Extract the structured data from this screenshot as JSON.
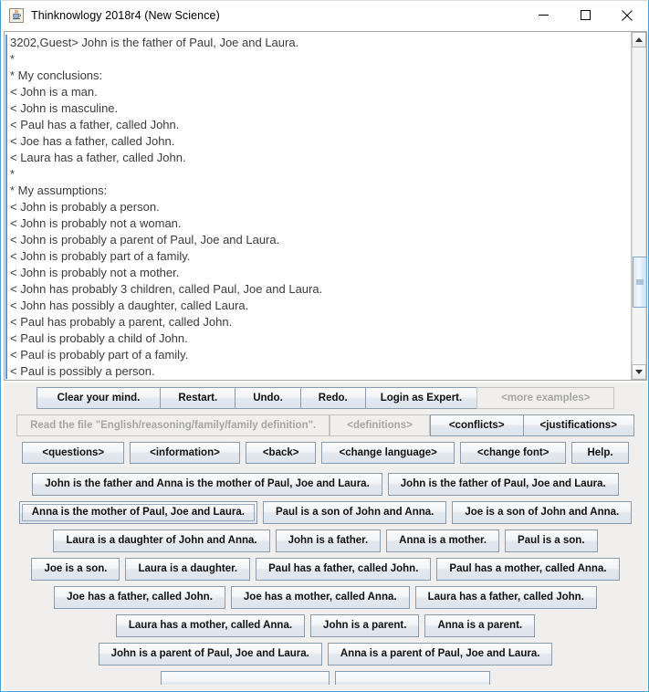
{
  "window": {
    "title": "Thinknowlogy 2018r4 (New Science)",
    "app_icon": "java-coffee-cup-icon",
    "minimize_label": "—",
    "maximize_label": "□",
    "close_label": "✕",
    "border_color": "#4a9fd8"
  },
  "output": {
    "lines": [
      "3202,Guest> John is the father of Paul, Joe and Laura.",
      "*",
      "* My conclusions:",
      "< John is a man.",
      "< John is masculine.",
      "< Paul has a father, called John.",
      "< Joe has a father, called John.",
      "< Laura has a father, called John.",
      "*",
      "* My assumptions:",
      "< John is probably a person.",
      "< John is probably not a woman.",
      "< John is probably a parent of Paul, Joe and Laura.",
      "< John is probably part of a family.",
      "< John is probably not a mother.",
      "< John has probably 3 children, called Paul, Joe and Laura.",
      "< John has possibly a daughter, called Laura.",
      "< Paul has probably a parent, called John.",
      "< Paul is probably a child of John.",
      "< Paul is probably part of a family.",
      "< Paul is possibly a person."
    ],
    "scrollbar": {
      "up_arrow": "scroll-up-arrow-icon",
      "down_arrow": "scroll-down-arrow-icon",
      "thumb_top_pct": 66,
      "thumb_height_pct": 16
    }
  },
  "toolbar": [
    {
      "label": "Clear your mind.",
      "enabled": true
    },
    {
      "label": "Restart.",
      "enabled": true
    },
    {
      "label": "Undo.",
      "enabled": true
    },
    {
      "label": "Redo.",
      "enabled": true
    },
    {
      "label": "Login as Expert.",
      "enabled": true
    },
    {
      "label": "<more examples>",
      "enabled": false
    }
  ],
  "file_row": [
    {
      "label": "Read the file \"English/reasoning/family/family definition\".",
      "enabled": false
    },
    {
      "label": "<definitions>",
      "enabled": false
    },
    {
      "label": "<conflicts>",
      "enabled": true
    },
    {
      "label": "<justifications>",
      "enabled": true
    }
  ],
  "nav_row": [
    {
      "label": "<questions>",
      "enabled": true
    },
    {
      "label": "<information>",
      "enabled": true
    },
    {
      "label": "<back>",
      "enabled": true
    },
    {
      "label": "<change language>",
      "enabled": true
    },
    {
      "label": "<change font>",
      "enabled": true
    },
    {
      "label": "Help.",
      "enabled": true
    }
  ],
  "sentence_rows": [
    [
      {
        "label": "John is the father and Anna is the mother of Paul, Joe and Laura.",
        "focused": false
      },
      {
        "label": "John is the father of Paul, Joe and Laura.",
        "focused": false
      }
    ],
    [
      {
        "label": "Anna is the mother of Paul, Joe and Laura.",
        "focused": true
      },
      {
        "label": "Paul is a son of John and Anna.",
        "focused": false
      },
      {
        "label": "Joe is a son of John and Anna.",
        "focused": false
      }
    ],
    [
      {
        "label": "Laura is a daughter of John and Anna.",
        "focused": false
      },
      {
        "label": "John is a father.",
        "focused": false
      },
      {
        "label": "Anna is a mother.",
        "focused": false
      },
      {
        "label": "Paul is a son.",
        "focused": false
      }
    ],
    [
      {
        "label": "Joe is a son.",
        "focused": false
      },
      {
        "label": "Laura is a daughter.",
        "focused": false
      },
      {
        "label": "Paul has a father, called John.",
        "focused": false
      },
      {
        "label": "Paul has a mother, called Anna.",
        "focused": false
      }
    ],
    [
      {
        "label": "Joe has a father, called John.",
        "focused": false
      },
      {
        "label": "Joe has a mother, called Anna.",
        "focused": false
      },
      {
        "label": "Laura has a father, called John.",
        "focused": false
      }
    ],
    [
      {
        "label": "Laura has a mother, called Anna.",
        "focused": false
      },
      {
        "label": "John is a parent.",
        "focused": false
      },
      {
        "label": "Anna is a parent.",
        "focused": false
      }
    ],
    [
      {
        "label": "John is a parent of Paul, Joe and Laura.",
        "focused": false
      },
      {
        "label": "Anna is a parent of Paul, Joe and Laura.",
        "focused": false
      }
    ],
    [
      {
        "label": "",
        "focused": false
      },
      {
        "label": "",
        "focused": false
      }
    ]
  ],
  "colors": {
    "panel_background": "#f0efee",
    "button_border": "#8a9bb0",
    "disabled_text": "#a6a6a6",
    "text_color": "#3b3b3b",
    "caret": "#5b9bd5"
  }
}
